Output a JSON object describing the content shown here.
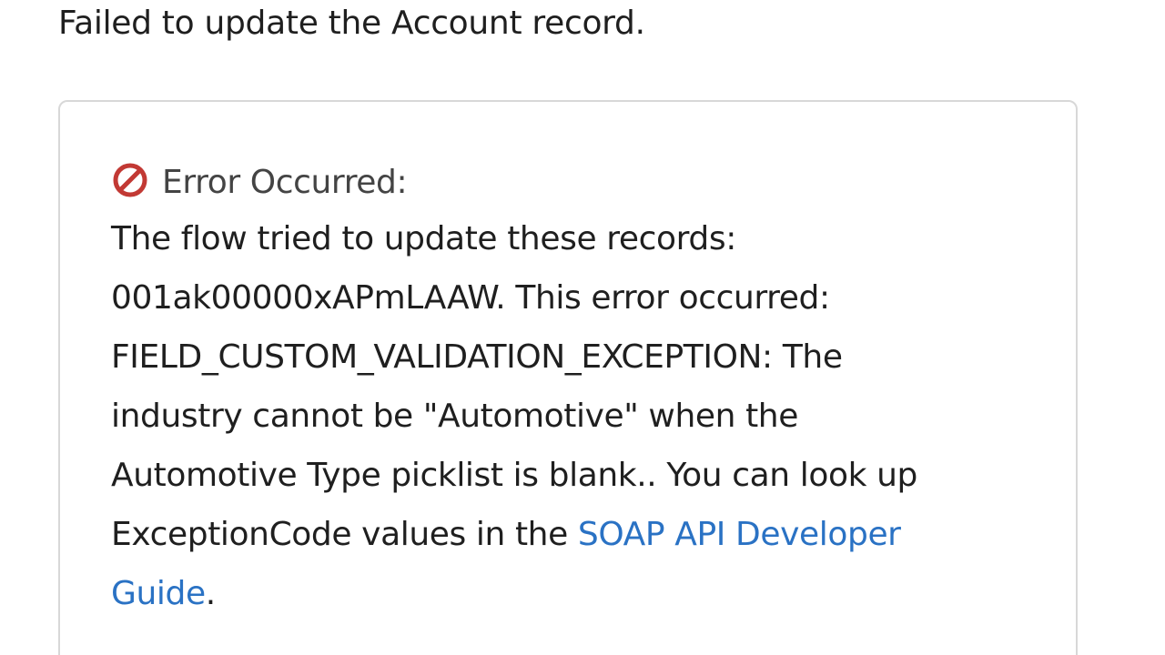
{
  "headline": "Failed to update the Account record.",
  "error": {
    "title": "Error Occurred:",
    "icon": "prohibited-icon",
    "icon_color": "#c23934",
    "lines": [
      "The flow tried to update these records:",
      "001ak00000xAPmLAAW. This error occurred:",
      "FIELD_CUSTOM_VALIDATION_EXCEPTION: The",
      "industry cannot be \"Automotive\" when the",
      "Automotive Type picklist is blank.. You can look up",
      "ExceptionCode values in the "
    ],
    "link_part1": "SOAP API Developer",
    "link_part2": "Guide",
    "trailing_period": ".",
    "link_color": "#2a72c4"
  }
}
